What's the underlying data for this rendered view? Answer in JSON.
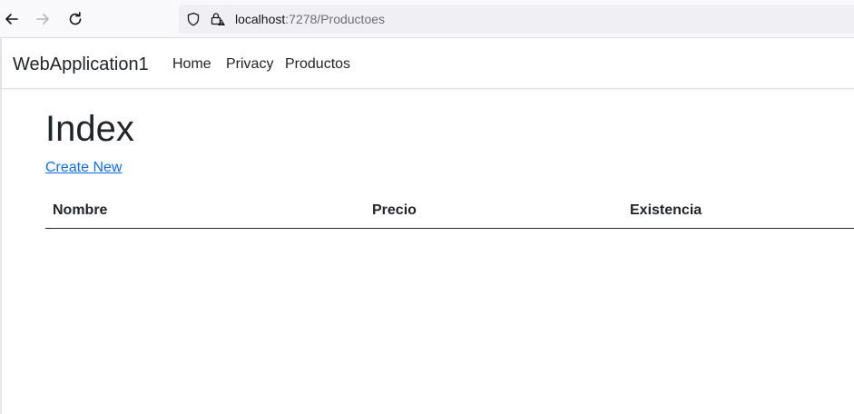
{
  "browser": {
    "icons": {
      "back": "arrow-left-icon",
      "forward": "arrow-right-icon",
      "reload": "reload-icon",
      "shield": "shield-icon",
      "lock": "lock-warning-icon"
    },
    "url": {
      "host": "localhost",
      "path": ":7278/Productoes"
    }
  },
  "navbar": {
    "brand": "WebApplication1",
    "links": [
      {
        "label": "Home"
      },
      {
        "label": "Privacy"
      },
      {
        "label": "Productos"
      }
    ]
  },
  "main": {
    "title": "Index",
    "create_link": "Create New",
    "table": {
      "headers": [
        "Nombre",
        "Precio",
        "Existencia"
      ],
      "rows": []
    }
  },
  "colors": {
    "link": "#0d6efd",
    "text": "#212529",
    "toolbar_bg": "#f9f9fb",
    "urlbar_bg": "#f0f0f4"
  }
}
